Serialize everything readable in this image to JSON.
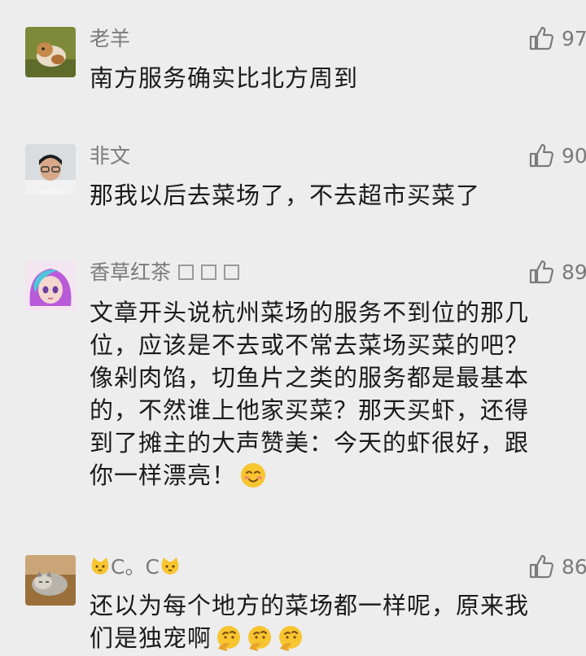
{
  "comments": [
    {
      "name": "老羊",
      "likes": "97",
      "text": "南方服务确实比北方周到",
      "avatar": "dog-photo-avatar"
    },
    {
      "name": "非文",
      "likes": "90",
      "text": "那我以后去菜场了，不去超市买菜了",
      "avatar": "person-photo-avatar"
    },
    {
      "name": "香草红茶",
      "likes": "89",
      "text_lines": [
        "文章开头说杭州菜场的服务不到位的那几",
        "位，应该是不去或不常去菜场买菜的吧？",
        "像剁肉馅，切鱼片之类的服务都是最基本",
        "的，不然谁上他家买菜？那天买虾，还得",
        "到了摊主的大声赞美：今天的虾很好，跟",
        "你一样漂亮！"
      ],
      "avatar": "anime-girl-avatar"
    },
    {
      "name": "C。C",
      "likes": "86",
      "text_lines": [
        "还以为每个地方的菜场都一样呢，原来我",
        "们是独宠啊"
      ],
      "avatar": "cat-photo-avatar"
    }
  ],
  "colors": {
    "background": "#ededed",
    "name": "#7b7b7b",
    "text": "#1a1a1a",
    "emoji": "#f7c530"
  },
  "icons": {
    "like": "thumbs-up-icon",
    "smile": "blushing-smile-emoji",
    "think": "thinking-face-emoji",
    "cat": "cat-face-emoji"
  }
}
